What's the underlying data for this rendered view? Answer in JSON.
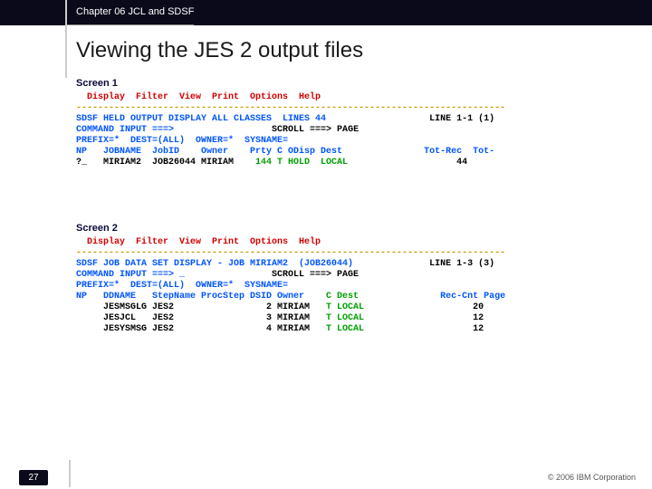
{
  "header": {
    "chapter": "Chapter 06 JCL and SDSF"
  },
  "title": "Viewing the JES 2 output files",
  "screen1": {
    "label": "Screen 1",
    "menu": "  Display  Filter  View  Print  Options  Help",
    "rule": "-------------------------------------------------------------------------------",
    "row1a": "SDSF HELD OUTPUT DISPLAY ALL CLASSES  LINES 44",
    "row1b": "                   LINE 1-1 (1)",
    "row2a": "COMMAND INPUT ===>",
    "row2b": "                  SCROLL ===> PAGE",
    "row3": "PREFIX=*  DEST=(ALL)  OWNER=*  SYSNAME=",
    "row4a": "NP   JOBNAME  JobID    Owner    Prty C ODisp Dest",
    "row4b": "               Tot-Rec  Tot-",
    "row5a": "?_   MIRIAM2  JOB26044 MIRIAM   ",
    "row5b": " 144 T HOLD  LOCAL",
    "row5c": "                    44"
  },
  "screen2": {
    "label": "Screen 2",
    "menu": "  Display  Filter  View  Print  Options  Help",
    "rule": "-------------------------------------------------------------------------------",
    "row1a": "SDSF JOB DATA SET DISPLAY - JOB MIRIAM2  (JOB26044)",
    "row1b": "              LINE 1-3 (3)",
    "row2a": "COMMAND INPUT ===> _",
    "row2b": "                SCROLL ===> PAGE",
    "row3": "PREFIX=*  DEST=(ALL)  OWNER=*  SYSNAME=",
    "row4a": "NP   DDNAME   StepName ProcStep DSID Owner   ",
    "row4b": " C Dest",
    "row4c": "               Rec-Cnt Page",
    "d1a": "     JESMSGLG JES2                 2 MIRIAM  ",
    "d1b": " T LOCAL",
    "d1c": "                    20",
    "d2a": "     JESJCL   JES2                 3 MIRIAM  ",
    "d2b": " T LOCAL",
    "d2c": "                    12",
    "d3a": "     JESYSMSG JES2                 4 MIRIAM  ",
    "d3b": " T LOCAL",
    "d3c": "                    12"
  },
  "footer": {
    "page": "27",
    "copyright": "© 2006 IBM Corporation"
  }
}
